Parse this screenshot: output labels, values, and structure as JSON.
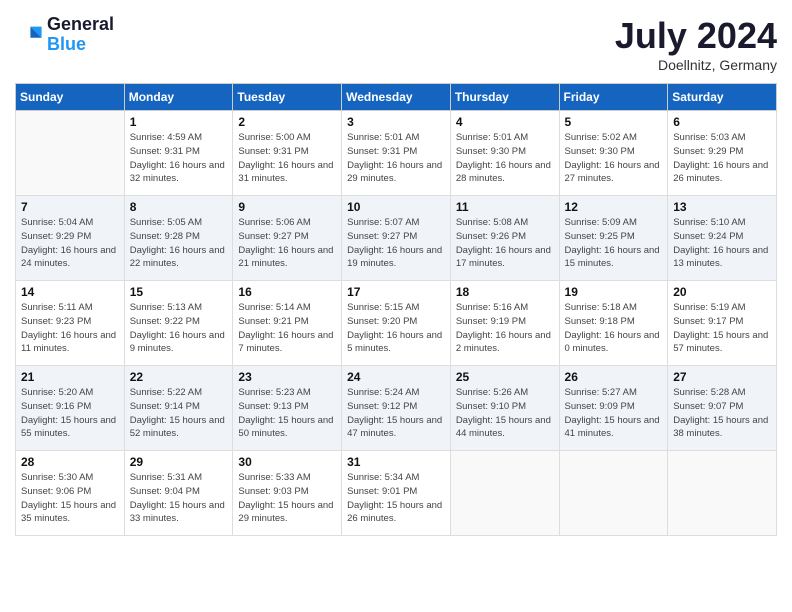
{
  "header": {
    "logo_line1": "General",
    "logo_line2": "Blue",
    "month": "July 2024",
    "location": "Doellnitz, Germany"
  },
  "weekdays": [
    "Sunday",
    "Monday",
    "Tuesday",
    "Wednesday",
    "Thursday",
    "Friday",
    "Saturday"
  ],
  "weeks": [
    [
      {
        "day": "",
        "info": ""
      },
      {
        "day": "1",
        "info": "Sunrise: 4:59 AM\nSunset: 9:31 PM\nDaylight: 16 hours\nand 32 minutes."
      },
      {
        "day": "2",
        "info": "Sunrise: 5:00 AM\nSunset: 9:31 PM\nDaylight: 16 hours\nand 31 minutes."
      },
      {
        "day": "3",
        "info": "Sunrise: 5:01 AM\nSunset: 9:31 PM\nDaylight: 16 hours\nand 29 minutes."
      },
      {
        "day": "4",
        "info": "Sunrise: 5:01 AM\nSunset: 9:30 PM\nDaylight: 16 hours\nand 28 minutes."
      },
      {
        "day": "5",
        "info": "Sunrise: 5:02 AM\nSunset: 9:30 PM\nDaylight: 16 hours\nand 27 minutes."
      },
      {
        "day": "6",
        "info": "Sunrise: 5:03 AM\nSunset: 9:29 PM\nDaylight: 16 hours\nand 26 minutes."
      }
    ],
    [
      {
        "day": "7",
        "info": "Sunrise: 5:04 AM\nSunset: 9:29 PM\nDaylight: 16 hours\nand 24 minutes."
      },
      {
        "day": "8",
        "info": "Sunrise: 5:05 AM\nSunset: 9:28 PM\nDaylight: 16 hours\nand 22 minutes."
      },
      {
        "day": "9",
        "info": "Sunrise: 5:06 AM\nSunset: 9:27 PM\nDaylight: 16 hours\nand 21 minutes."
      },
      {
        "day": "10",
        "info": "Sunrise: 5:07 AM\nSunset: 9:27 PM\nDaylight: 16 hours\nand 19 minutes."
      },
      {
        "day": "11",
        "info": "Sunrise: 5:08 AM\nSunset: 9:26 PM\nDaylight: 16 hours\nand 17 minutes."
      },
      {
        "day": "12",
        "info": "Sunrise: 5:09 AM\nSunset: 9:25 PM\nDaylight: 16 hours\nand 15 minutes."
      },
      {
        "day": "13",
        "info": "Sunrise: 5:10 AM\nSunset: 9:24 PM\nDaylight: 16 hours\nand 13 minutes."
      }
    ],
    [
      {
        "day": "14",
        "info": "Sunrise: 5:11 AM\nSunset: 9:23 PM\nDaylight: 16 hours\nand 11 minutes."
      },
      {
        "day": "15",
        "info": "Sunrise: 5:13 AM\nSunset: 9:22 PM\nDaylight: 16 hours\nand 9 minutes."
      },
      {
        "day": "16",
        "info": "Sunrise: 5:14 AM\nSunset: 9:21 PM\nDaylight: 16 hours\nand 7 minutes."
      },
      {
        "day": "17",
        "info": "Sunrise: 5:15 AM\nSunset: 9:20 PM\nDaylight: 16 hours\nand 5 minutes."
      },
      {
        "day": "18",
        "info": "Sunrise: 5:16 AM\nSunset: 9:19 PM\nDaylight: 16 hours\nand 2 minutes."
      },
      {
        "day": "19",
        "info": "Sunrise: 5:18 AM\nSunset: 9:18 PM\nDaylight: 16 hours\nand 0 minutes."
      },
      {
        "day": "20",
        "info": "Sunrise: 5:19 AM\nSunset: 9:17 PM\nDaylight: 15 hours\nand 57 minutes."
      }
    ],
    [
      {
        "day": "21",
        "info": "Sunrise: 5:20 AM\nSunset: 9:16 PM\nDaylight: 15 hours\nand 55 minutes."
      },
      {
        "day": "22",
        "info": "Sunrise: 5:22 AM\nSunset: 9:14 PM\nDaylight: 15 hours\nand 52 minutes."
      },
      {
        "day": "23",
        "info": "Sunrise: 5:23 AM\nSunset: 9:13 PM\nDaylight: 15 hours\nand 50 minutes."
      },
      {
        "day": "24",
        "info": "Sunrise: 5:24 AM\nSunset: 9:12 PM\nDaylight: 15 hours\nand 47 minutes."
      },
      {
        "day": "25",
        "info": "Sunrise: 5:26 AM\nSunset: 9:10 PM\nDaylight: 15 hours\nand 44 minutes."
      },
      {
        "day": "26",
        "info": "Sunrise: 5:27 AM\nSunset: 9:09 PM\nDaylight: 15 hours\nand 41 minutes."
      },
      {
        "day": "27",
        "info": "Sunrise: 5:28 AM\nSunset: 9:07 PM\nDaylight: 15 hours\nand 38 minutes."
      }
    ],
    [
      {
        "day": "28",
        "info": "Sunrise: 5:30 AM\nSunset: 9:06 PM\nDaylight: 15 hours\nand 35 minutes."
      },
      {
        "day": "29",
        "info": "Sunrise: 5:31 AM\nSunset: 9:04 PM\nDaylight: 15 hours\nand 33 minutes."
      },
      {
        "day": "30",
        "info": "Sunrise: 5:33 AM\nSunset: 9:03 PM\nDaylight: 15 hours\nand 29 minutes."
      },
      {
        "day": "31",
        "info": "Sunrise: 5:34 AM\nSunset: 9:01 PM\nDaylight: 15 hours\nand 26 minutes."
      },
      {
        "day": "",
        "info": ""
      },
      {
        "day": "",
        "info": ""
      },
      {
        "day": "",
        "info": ""
      }
    ]
  ]
}
